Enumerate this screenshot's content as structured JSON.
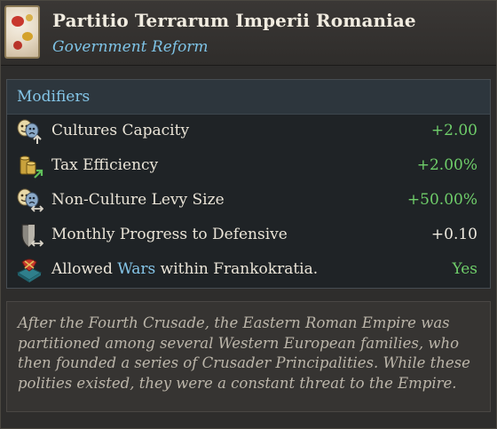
{
  "header": {
    "title": "Partitio Terrarum Imperii Romaniae",
    "subtitle": "Government Reform",
    "emblem_icon": "reform-emblem-icon"
  },
  "modifiers": {
    "heading": "Modifiers",
    "items": [
      {
        "icon": "theater-masks-capacity-icon",
        "label": "Cultures Capacity",
        "value": "+2.00",
        "value_color": "#6fce6a"
      },
      {
        "icon": "gold-coins-tax-icon",
        "label": "Tax Efficiency",
        "value": "+2.00%",
        "value_color": "#6fce6a"
      },
      {
        "icon": "theater-masks-levy-icon",
        "label": "Non-Culture Levy Size",
        "value": "+50.00%",
        "value_color": "#6fce6a"
      },
      {
        "icon": "shield-defensive-icon",
        "label": "Monthly Progress to Defensive",
        "value": "+0.10",
        "value_color": "#eeeae0"
      },
      {
        "icon": "war-book-icon",
        "label_prefix": "Allowed ",
        "label_highlight": "Wars",
        "label_suffix": " within Frankokratia.",
        "value": "Yes",
        "value_color": "#6fce6a"
      }
    ]
  },
  "description": "After the Fourth Crusade, the Eastern Roman Empire was partitioned among several Western European families, who then founded a series of Crusader Principalities. While these polities existed, they were a constant threat to the Empire."
}
